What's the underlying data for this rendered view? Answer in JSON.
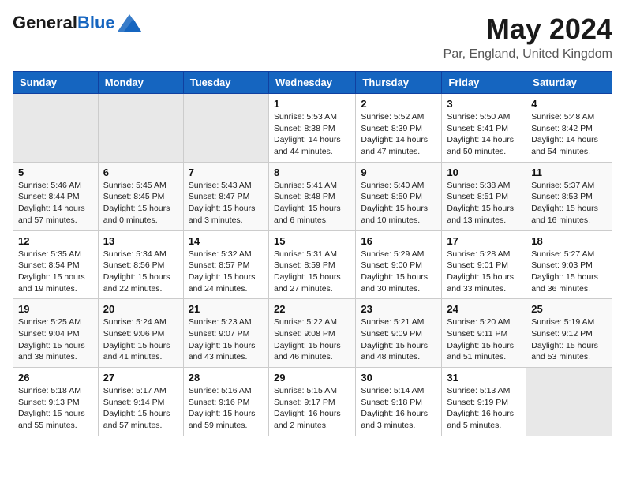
{
  "header": {
    "logo_general": "General",
    "logo_blue": "Blue",
    "title": "May 2024",
    "subtitle": "Par, England, United Kingdom"
  },
  "calendar": {
    "days_of_week": [
      "Sunday",
      "Monday",
      "Tuesday",
      "Wednesday",
      "Thursday",
      "Friday",
      "Saturday"
    ],
    "weeks": [
      [
        {
          "day": "",
          "info": ""
        },
        {
          "day": "",
          "info": ""
        },
        {
          "day": "",
          "info": ""
        },
        {
          "day": "1",
          "info": "Sunrise: 5:53 AM\nSunset: 8:38 PM\nDaylight: 14 hours\nand 44 minutes."
        },
        {
          "day": "2",
          "info": "Sunrise: 5:52 AM\nSunset: 8:39 PM\nDaylight: 14 hours\nand 47 minutes."
        },
        {
          "day": "3",
          "info": "Sunrise: 5:50 AM\nSunset: 8:41 PM\nDaylight: 14 hours\nand 50 minutes."
        },
        {
          "day": "4",
          "info": "Sunrise: 5:48 AM\nSunset: 8:42 PM\nDaylight: 14 hours\nand 54 minutes."
        }
      ],
      [
        {
          "day": "5",
          "info": "Sunrise: 5:46 AM\nSunset: 8:44 PM\nDaylight: 14 hours\nand 57 minutes."
        },
        {
          "day": "6",
          "info": "Sunrise: 5:45 AM\nSunset: 8:45 PM\nDaylight: 15 hours\nand 0 minutes."
        },
        {
          "day": "7",
          "info": "Sunrise: 5:43 AM\nSunset: 8:47 PM\nDaylight: 15 hours\nand 3 minutes."
        },
        {
          "day": "8",
          "info": "Sunrise: 5:41 AM\nSunset: 8:48 PM\nDaylight: 15 hours\nand 6 minutes."
        },
        {
          "day": "9",
          "info": "Sunrise: 5:40 AM\nSunset: 8:50 PM\nDaylight: 15 hours\nand 10 minutes."
        },
        {
          "day": "10",
          "info": "Sunrise: 5:38 AM\nSunset: 8:51 PM\nDaylight: 15 hours\nand 13 minutes."
        },
        {
          "day": "11",
          "info": "Sunrise: 5:37 AM\nSunset: 8:53 PM\nDaylight: 15 hours\nand 16 minutes."
        }
      ],
      [
        {
          "day": "12",
          "info": "Sunrise: 5:35 AM\nSunset: 8:54 PM\nDaylight: 15 hours\nand 19 minutes."
        },
        {
          "day": "13",
          "info": "Sunrise: 5:34 AM\nSunset: 8:56 PM\nDaylight: 15 hours\nand 22 minutes."
        },
        {
          "day": "14",
          "info": "Sunrise: 5:32 AM\nSunset: 8:57 PM\nDaylight: 15 hours\nand 24 minutes."
        },
        {
          "day": "15",
          "info": "Sunrise: 5:31 AM\nSunset: 8:59 PM\nDaylight: 15 hours\nand 27 minutes."
        },
        {
          "day": "16",
          "info": "Sunrise: 5:29 AM\nSunset: 9:00 PM\nDaylight: 15 hours\nand 30 minutes."
        },
        {
          "day": "17",
          "info": "Sunrise: 5:28 AM\nSunset: 9:01 PM\nDaylight: 15 hours\nand 33 minutes."
        },
        {
          "day": "18",
          "info": "Sunrise: 5:27 AM\nSunset: 9:03 PM\nDaylight: 15 hours\nand 36 minutes."
        }
      ],
      [
        {
          "day": "19",
          "info": "Sunrise: 5:25 AM\nSunset: 9:04 PM\nDaylight: 15 hours\nand 38 minutes."
        },
        {
          "day": "20",
          "info": "Sunrise: 5:24 AM\nSunset: 9:06 PM\nDaylight: 15 hours\nand 41 minutes."
        },
        {
          "day": "21",
          "info": "Sunrise: 5:23 AM\nSunset: 9:07 PM\nDaylight: 15 hours\nand 43 minutes."
        },
        {
          "day": "22",
          "info": "Sunrise: 5:22 AM\nSunset: 9:08 PM\nDaylight: 15 hours\nand 46 minutes."
        },
        {
          "day": "23",
          "info": "Sunrise: 5:21 AM\nSunset: 9:09 PM\nDaylight: 15 hours\nand 48 minutes."
        },
        {
          "day": "24",
          "info": "Sunrise: 5:20 AM\nSunset: 9:11 PM\nDaylight: 15 hours\nand 51 minutes."
        },
        {
          "day": "25",
          "info": "Sunrise: 5:19 AM\nSunset: 9:12 PM\nDaylight: 15 hours\nand 53 minutes."
        }
      ],
      [
        {
          "day": "26",
          "info": "Sunrise: 5:18 AM\nSunset: 9:13 PM\nDaylight: 15 hours\nand 55 minutes."
        },
        {
          "day": "27",
          "info": "Sunrise: 5:17 AM\nSunset: 9:14 PM\nDaylight: 15 hours\nand 57 minutes."
        },
        {
          "day": "28",
          "info": "Sunrise: 5:16 AM\nSunset: 9:16 PM\nDaylight: 15 hours\nand 59 minutes."
        },
        {
          "day": "29",
          "info": "Sunrise: 5:15 AM\nSunset: 9:17 PM\nDaylight: 16 hours\nand 2 minutes."
        },
        {
          "day": "30",
          "info": "Sunrise: 5:14 AM\nSunset: 9:18 PM\nDaylight: 16 hours\nand 3 minutes."
        },
        {
          "day": "31",
          "info": "Sunrise: 5:13 AM\nSunset: 9:19 PM\nDaylight: 16 hours\nand 5 minutes."
        },
        {
          "day": "",
          "info": ""
        }
      ]
    ]
  }
}
